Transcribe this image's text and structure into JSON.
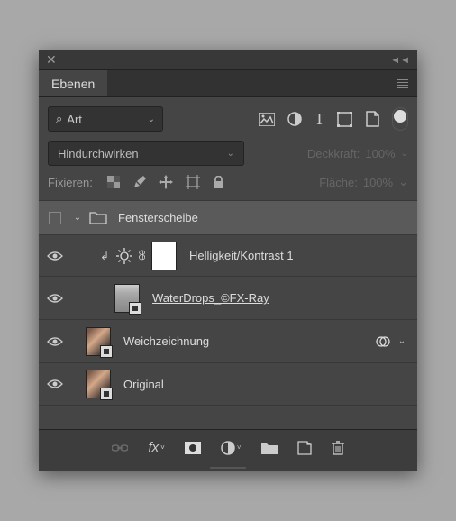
{
  "panel": {
    "title": "Ebenen"
  },
  "filter": {
    "label": "Art"
  },
  "blend": {
    "mode": "Hindurchwirken"
  },
  "opacity": {
    "label": "Deckkraft:",
    "value": "100%"
  },
  "lock": {
    "label": "Fixieren:"
  },
  "fill": {
    "label": "Fläche:",
    "value": "100%"
  },
  "layers": {
    "group": {
      "name": "Fensterscheibe"
    },
    "adj": {
      "name": "Helligkeit/Kontrast 1"
    },
    "drops": {
      "name": "WaterDrops_©FX-Ray"
    },
    "blur": {
      "name": "Weichzeichnung"
    },
    "orig": {
      "name": "Original"
    }
  }
}
